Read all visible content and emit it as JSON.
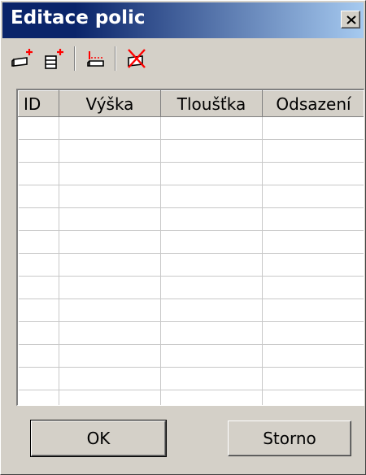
{
  "window": {
    "title": "Editace polic",
    "close_label": "×"
  },
  "toolbar": {
    "buttons": [
      {
        "icon": "add-shelf-icon"
      },
      {
        "icon": "add-stacked-shelves-icon"
      },
      {
        "icon": "offset-shelf-icon"
      },
      {
        "icon": "delete-shelf-icon"
      }
    ],
    "accent_color": "#ff0000"
  },
  "table": {
    "columns": [
      "ID",
      "Výška",
      "Tloušťka",
      "Odsazení"
    ],
    "rows": []
  },
  "buttons": {
    "ok_label": "OK",
    "cancel_label": "Storno"
  },
  "colors": {
    "title_bar_start": "#0a246a",
    "title_bar_end": "#a6caf0",
    "face": "#d4d0c8"
  }
}
